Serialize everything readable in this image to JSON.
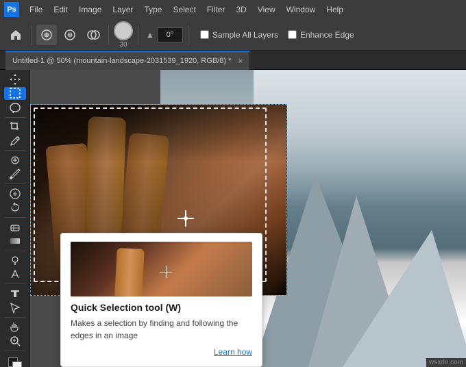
{
  "app": {
    "logo": "Ps",
    "logo_color": "#1473e6"
  },
  "menu": {
    "items": [
      "File",
      "Edit",
      "Image",
      "Layer",
      "Type",
      "Select",
      "Filter",
      "3D",
      "View",
      "Window",
      "Help"
    ]
  },
  "toolbar": {
    "tools": [
      {
        "name": "home",
        "icon": "⌂",
        "active": false
      },
      {
        "name": "quick-selection",
        "icon": "◎",
        "active": false
      },
      {
        "name": "magic-wand",
        "icon": "✦",
        "active": false
      },
      {
        "name": "lasso",
        "icon": "⌖",
        "active": false
      }
    ],
    "brush_size": "30",
    "angle_label": "0°",
    "sample_all_layers_label": "Sample All Layers",
    "enhance_edge_label": "Enhance Edge",
    "sample_all_layers_checked": false,
    "enhance_edge_checked": false
  },
  "tab": {
    "title": "Untitled-1 @ 50% (mountain-landscape-2031539_1920, RGB/8) *",
    "close_icon": "×"
  },
  "tooltip": {
    "title": "Quick Selection tool (W)",
    "description": "Makes a selection by finding and following the edges in an image",
    "learn_link": "Learn how"
  },
  "status": {
    "label": "wsxdn.com"
  }
}
